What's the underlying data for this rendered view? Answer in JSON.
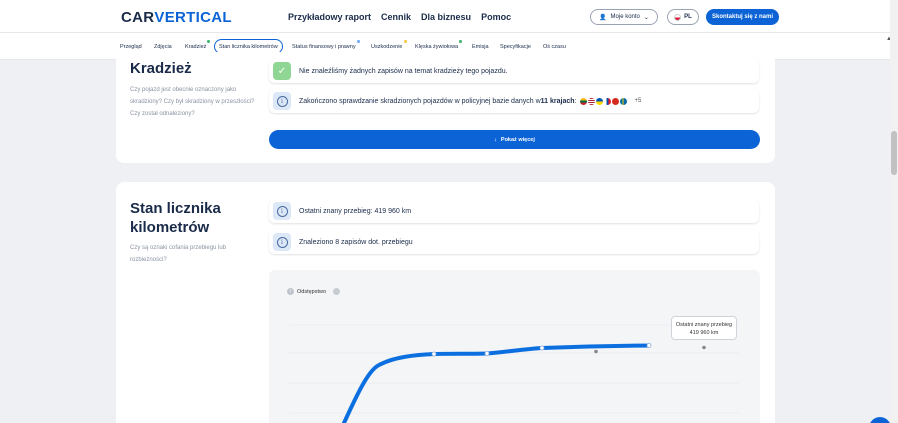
{
  "header": {
    "logo_main": "CAR",
    "logo_rest": "VERTICAL",
    "nav": [
      "Przykładowy raport",
      "Cennik",
      "Dla biznesu",
      "Pomoc"
    ],
    "account_label": "Moje konto",
    "lang_label": "PL",
    "contact_label": "Skontaktuj się z nami"
  },
  "tabs": [
    {
      "label": "Przegląd",
      "dot": ""
    },
    {
      "label": "Zdjęcia",
      "dot": ""
    },
    {
      "label": "Kradzież",
      "dot": "#3cb371"
    },
    {
      "label": "Stan licznika kilometrów",
      "dot": ""
    },
    {
      "label": "Status finansowy i prawny",
      "dot": "#6ea8fe"
    },
    {
      "label": "Uszkodzenie",
      "dot": "#f5c542"
    },
    {
      "label": "Klęska żywiołowa",
      "dot": "#3cb371"
    },
    {
      "label": "Emisja",
      "dot": ""
    },
    {
      "label": "Specyfikacje",
      "dot": ""
    },
    {
      "label": "Oś czasu",
      "dot": ""
    }
  ],
  "theft": {
    "title": "Kradzież",
    "description": "Czy pojazd jest obecnie oznaczony jako skradziony? Czy był skradziony w przeszłości? Czy został odnaleziony?",
    "row1": "Nie znaleźliśmy żadnych zapisów na temat kradzieży tego pojazdu.",
    "row2_prefix": "Zakończono sprawdzanie skradzionych pojazdów w policyjnej bazie danych w ",
    "row2_bold": "11 krajach",
    "row2_suffix": ":",
    "more_countries": "+5",
    "show_more": "Pokaż więcej"
  },
  "odometer": {
    "title_line1": "Stan licznika",
    "title_line2": "kilometrów",
    "description": "Czy są oznaki cofania przebiegu lub rozbieżności?",
    "row1": "Ostatni znany przebieg: 419 960 km",
    "row2": "Znaleziono 8 zapisów dot. przebiegu",
    "legend_label": "Odstępstwo",
    "tooltip_line1": "Ostatni znany przebieg",
    "tooltip_line2": "419 960 km"
  },
  "colors": {
    "accent": "#0b63d6",
    "success": "#8fd694"
  }
}
